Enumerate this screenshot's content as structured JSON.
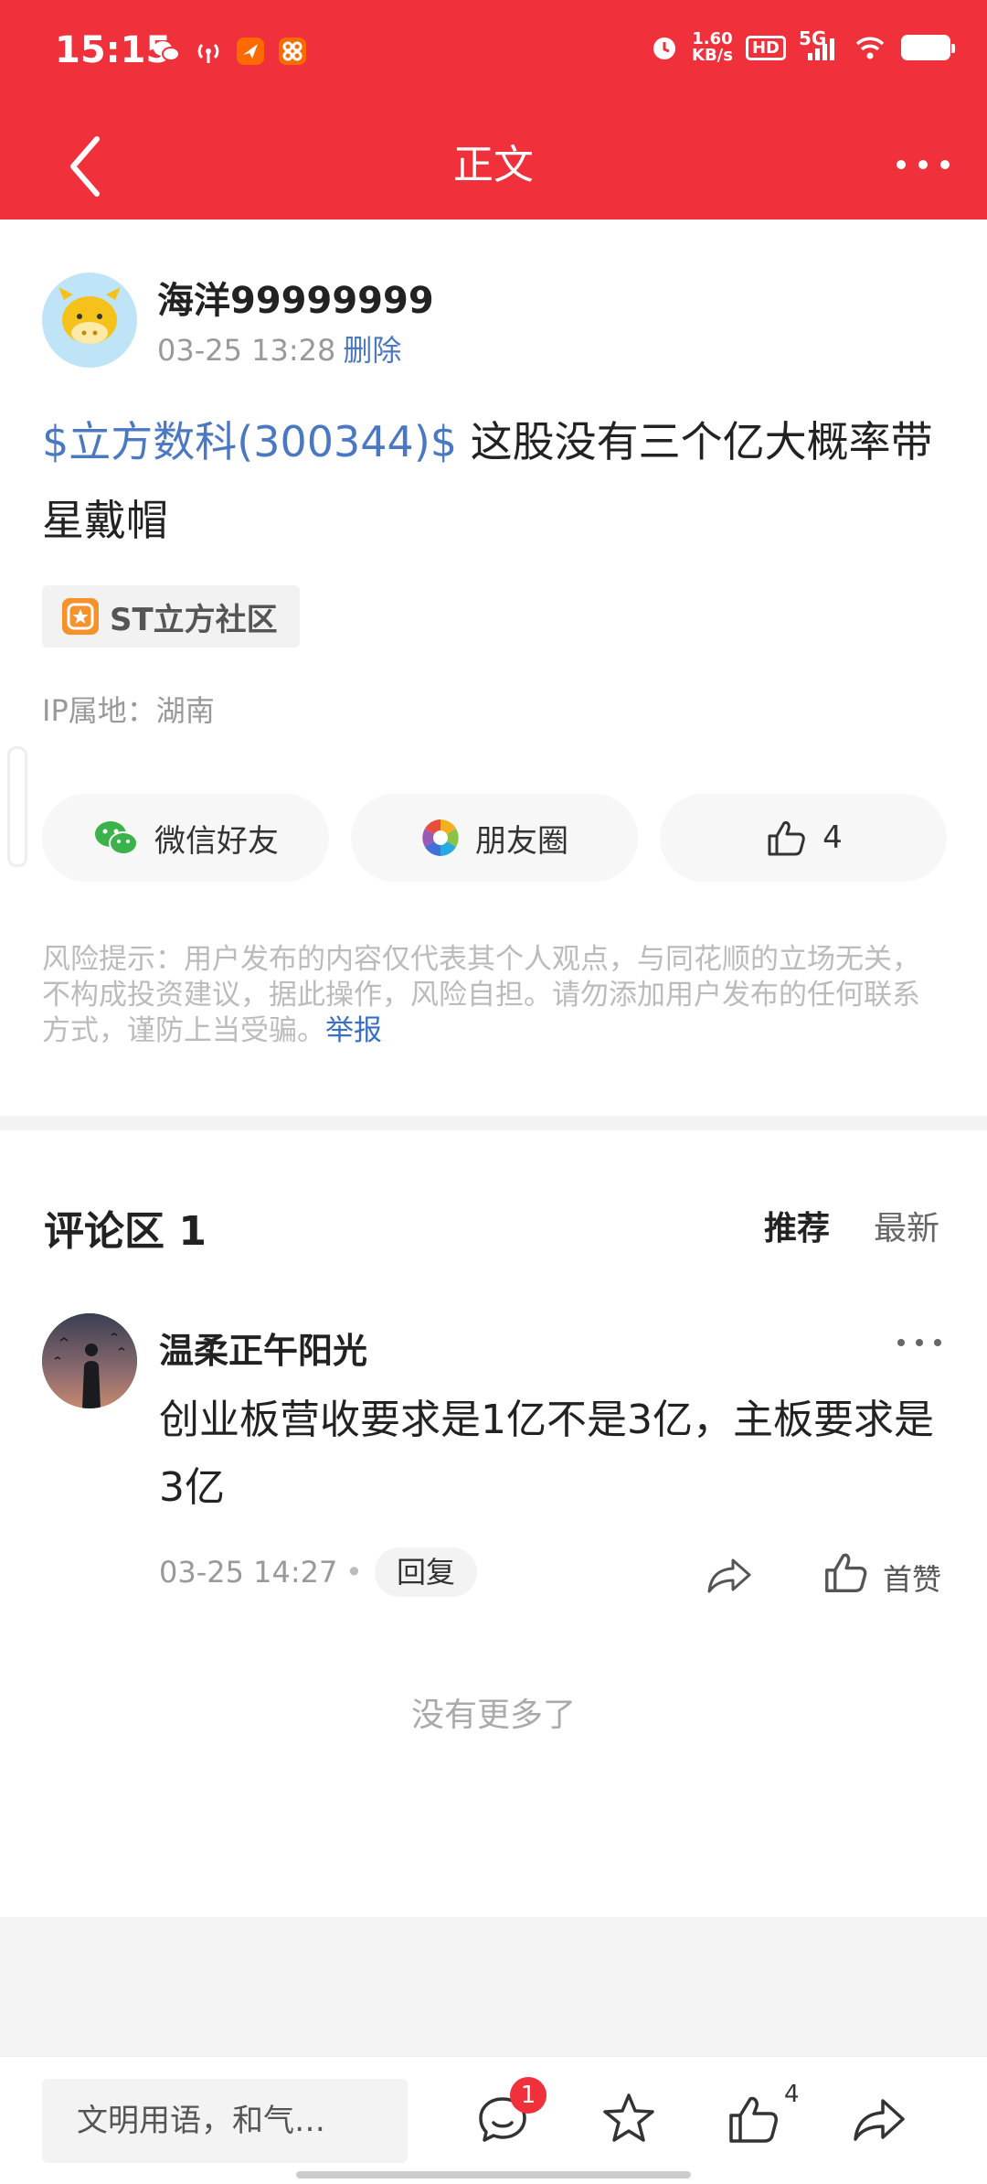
{
  "status_bar": {
    "time": "15:15",
    "net_speed_value": "1.60",
    "net_speed_unit": "KB/s",
    "hd": "HD",
    "network": "5G"
  },
  "nav": {
    "title": "正文"
  },
  "post": {
    "author": "海洋99999999",
    "date": "03-25 13:28",
    "delete_label": "删除",
    "stock_link": "$立方数科(300344)$",
    "body_text": " 这股没有三个亿大概率带星戴帽",
    "topic": "ST立方社区",
    "ip_location": "IP属地：湖南",
    "share_wechat": "微信好友",
    "share_moments": "朋友圈",
    "like_count": "4",
    "risk_text": "风险提示：用户发布的内容仅代表其个人观点，与同花顺的立场无关，不构成投资建议，据此操作，风险自担。请勿添加用户发布的任何联系方式，谨防上当受骗。",
    "report_label": "举报"
  },
  "comments": {
    "title": "评论区 1",
    "sort_recommended": "推荐",
    "sort_latest": "最新",
    "items": [
      {
        "author": "温柔正午阳光",
        "text": "创业板营收要求是1亿不是3亿，主板要求是3亿",
        "date": "03-25 14:27",
        "dot": "•",
        "reply_label": "回复",
        "like_label": "首赞"
      }
    ],
    "no_more": "没有更多了"
  },
  "bottom_bar": {
    "input_placeholder": "文明用语，和气…",
    "comment_badge": "1",
    "like_count": "4"
  },
  "colors": {
    "brand_red": "#f0303b",
    "link_blue": "#4a78c2"
  }
}
